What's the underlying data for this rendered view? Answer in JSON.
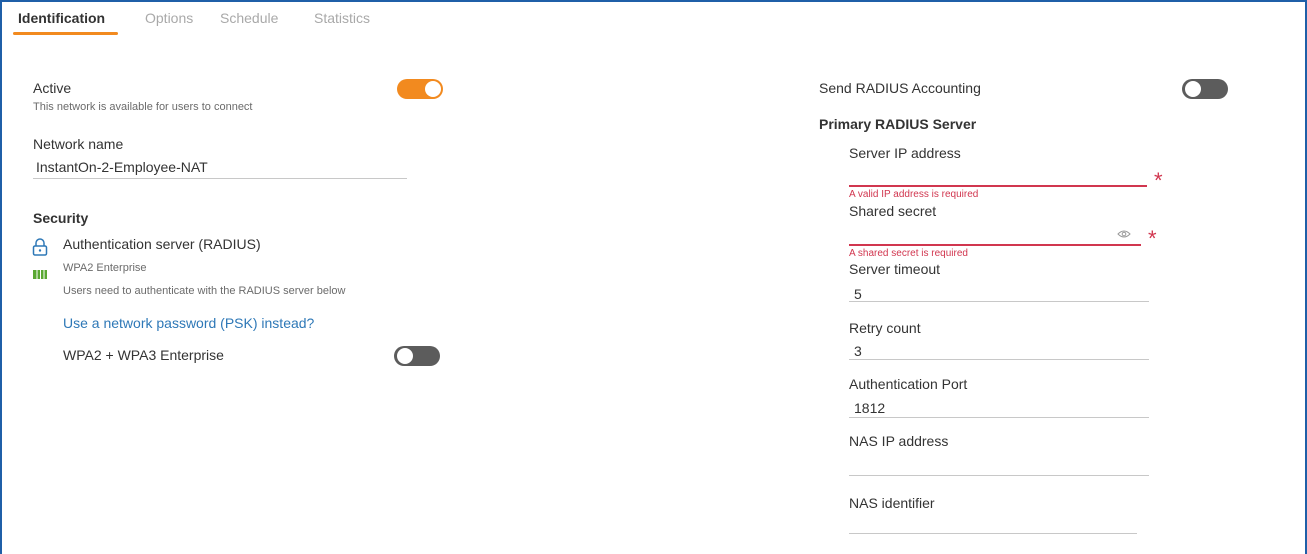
{
  "tabs": [
    {
      "label": "Identification"
    },
    {
      "label": "Options"
    },
    {
      "label": "Schedule"
    },
    {
      "label": "Statistics"
    }
  ],
  "left": {
    "active": {
      "label": "Active",
      "description": "This network is available for users to connect",
      "state": "on"
    },
    "network_name": {
      "label": "Network name",
      "value": "InstantOn-2-Employee-NAT"
    },
    "security": {
      "title": "Security",
      "auth_title": "Authentication server (RADIUS)",
      "auth_type": "WPA2 Enterprise",
      "auth_desc": "Users need to authenticate with the RADIUS server below",
      "psk_link": "Use a network password (PSK) instead?",
      "wpa3": {
        "label": "WPA2 + WPA3 Enterprise",
        "state": "off"
      }
    }
  },
  "right": {
    "accounting": {
      "label": "Send RADIUS Accounting",
      "state": "off"
    },
    "primary_title": "Primary RADIUS Server",
    "server_ip": {
      "label": "Server IP address",
      "value": "",
      "error": "A valid IP address is required"
    },
    "shared_secret": {
      "label": "Shared secret",
      "value": "",
      "error": "A shared secret is required"
    },
    "server_timeout": {
      "label": "Server timeout",
      "value": "5"
    },
    "retry_count": {
      "label": "Retry count",
      "value": "3"
    },
    "auth_port": {
      "label": "Authentication Port",
      "value": "1812"
    },
    "nas_ip": {
      "label": "NAS IP address",
      "value": ""
    },
    "nas_identifier": {
      "label": "NAS identifier",
      "value": ""
    }
  },
  "colors": {
    "accent": "#f28a1f",
    "error": "#d1364f",
    "link": "#2e78b7",
    "border": "#1f5fa8"
  }
}
